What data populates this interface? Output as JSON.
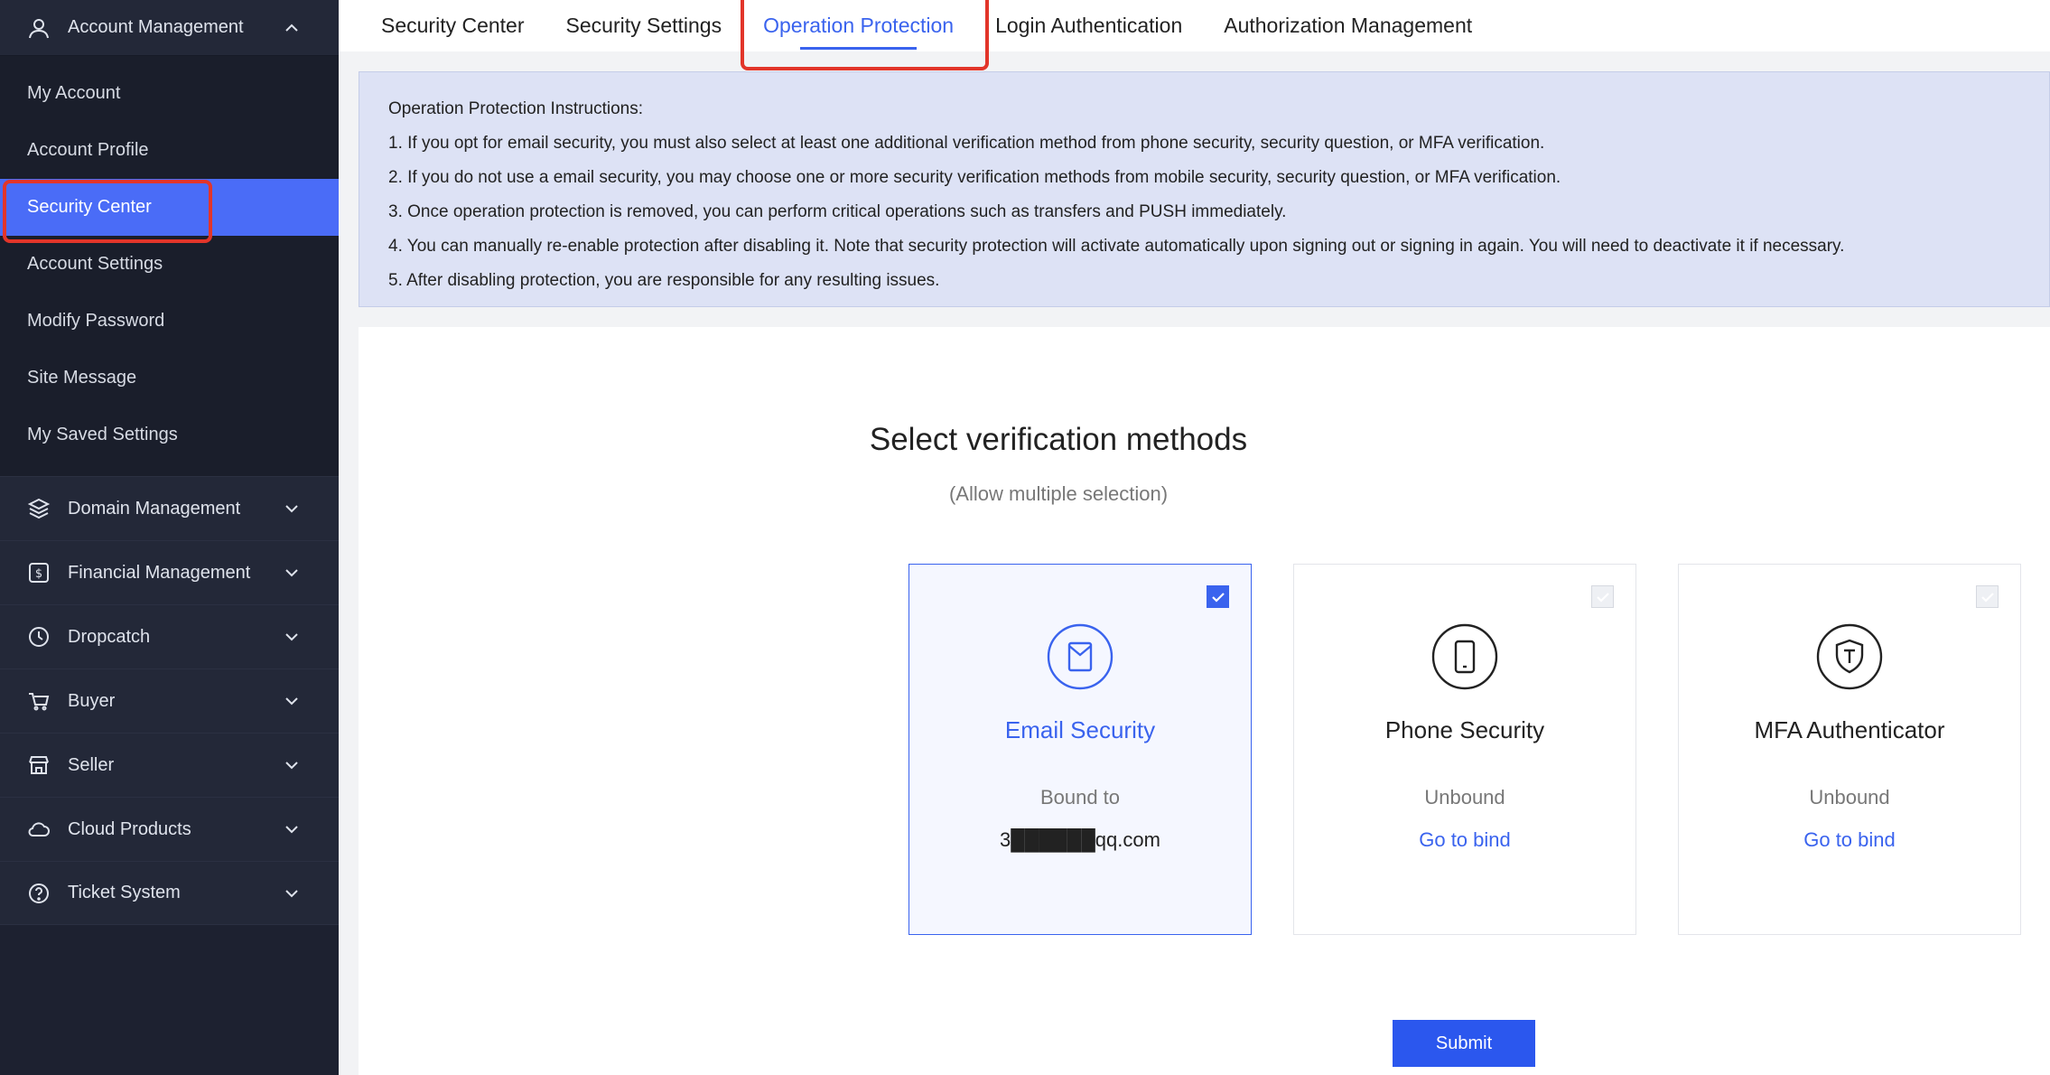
{
  "sidebar": {
    "group": {
      "label": "Account Management",
      "icon": "user-icon"
    },
    "items": [
      {
        "label": "My Account"
      },
      {
        "label": "Account Profile"
      },
      {
        "label": "Security Center",
        "active": true
      },
      {
        "label": "Account Settings"
      },
      {
        "label": "Modify Password"
      },
      {
        "label": "Site Message"
      },
      {
        "label": "My Saved Settings"
      }
    ],
    "sections": [
      {
        "label": "Domain Management",
        "icon": "layers-icon"
      },
      {
        "label": "Financial Management",
        "icon": "dollar-icon"
      },
      {
        "label": "Dropcatch",
        "icon": "clock-icon"
      },
      {
        "label": "Buyer",
        "icon": "cart-icon"
      },
      {
        "label": "Seller",
        "icon": "store-icon"
      },
      {
        "label": "Cloud Products",
        "icon": "cloud-icon"
      },
      {
        "label": "Ticket System",
        "icon": "help-icon"
      }
    ]
  },
  "tabs": [
    {
      "label": "Security Center"
    },
    {
      "label": "Security Settings"
    },
    {
      "label": "Operation Protection",
      "active": true
    },
    {
      "label": "Login Authentication"
    },
    {
      "label": "Authorization Management"
    }
  ],
  "instructions": {
    "title": "Operation Protection Instructions:",
    "lines": [
      "1. If you opt for email security, you must also select at least one additional verification method from phone security, security question, or MFA verification.",
      "2. If you do not use a email security, you may choose one or more security verification methods from mobile security, security question, or MFA verification.",
      "3. Once operation protection is removed, you can perform critical operations such as transfers and PUSH immediately.",
      "4. You can manually re-enable protection after disabling it. Note that security protection will activate automatically upon signing out or signing in again. You will need to deactivate it if necessary.",
      "5. After disabling protection, you are responsible for any resulting issues."
    ]
  },
  "main": {
    "title": "Select verification methods",
    "subtitle": "(Allow multiple selection)",
    "methods": [
      {
        "title": "Email Security",
        "status": "Bound to",
        "value": "3██████qq.com",
        "icon": "email-icon",
        "selected": true
      },
      {
        "title": "Phone Security",
        "status": "Unbound",
        "link": "Go to bind",
        "icon": "phone-icon",
        "selected": false
      },
      {
        "title": "MFA Authenticator",
        "status": "Unbound",
        "link": "Go to bind",
        "icon": "shield-icon",
        "selected": false
      }
    ],
    "submit_label": "Submit"
  },
  "colors": {
    "accent": "#3a63ee",
    "sidebar_bg": "#1d2130",
    "highlight": "#e2352a"
  }
}
